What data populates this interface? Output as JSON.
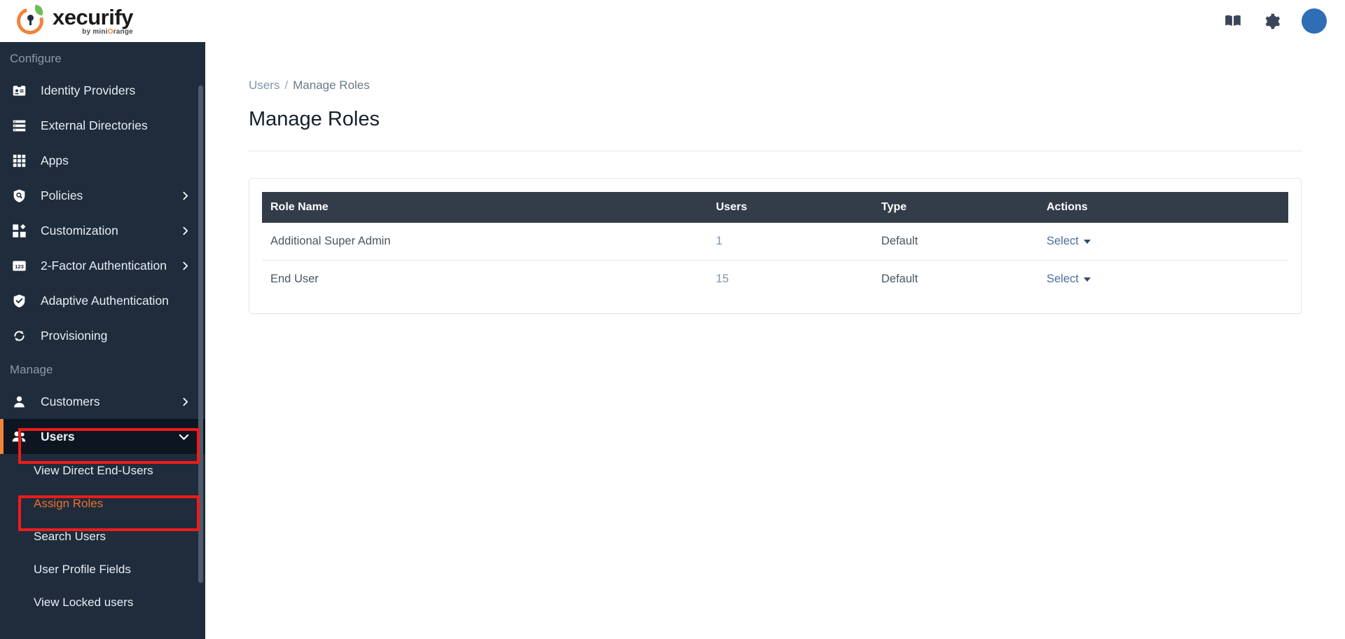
{
  "brand": {
    "name": "xecurify",
    "tagline_prefix": "by mini",
    "tagline_o": "O",
    "tagline_suffix": "range",
    "accent_color": "#f1843c",
    "logo_icon": "xecurify-lock-logo"
  },
  "topbar": {
    "icons": [
      {
        "name": "documentation-book-icon",
        "glyph": "book"
      },
      {
        "name": "settings-gear-icon",
        "glyph": "gear"
      }
    ],
    "avatar": {
      "name": "user-avatar",
      "color": "#2f6db5"
    }
  },
  "sidebar": {
    "sections": [
      {
        "label": "Configure",
        "items": [
          {
            "label": "Identity Providers",
            "icon": "id-badge-icon",
            "chevron": null
          },
          {
            "label": "External Directories",
            "icon": "directory-list-icon",
            "chevron": null
          },
          {
            "label": "Apps",
            "icon": "grid-apps-icon",
            "chevron": null
          },
          {
            "label": "Policies",
            "icon": "shield-search-icon",
            "chevron": "right"
          },
          {
            "label": "Customization",
            "icon": "puzzle-icon",
            "chevron": "right"
          },
          {
            "label": "2-Factor Authentication",
            "icon": "numeric-123-icon",
            "chevron": "right"
          },
          {
            "label": "Adaptive Authentication",
            "icon": "shield-check-icon",
            "chevron": null
          },
          {
            "label": "Provisioning",
            "icon": "sync-arrows-icon",
            "chevron": null
          }
        ]
      },
      {
        "label": "Manage",
        "items": [
          {
            "label": "Customers",
            "icon": "person-icon",
            "chevron": "right"
          },
          {
            "label": "Users",
            "icon": "people-group-icon",
            "chevron": "down",
            "active": true,
            "highlighted": true
          }
        ]
      }
    ],
    "submenu": [
      {
        "label": "View Direct End-Users",
        "selected": false,
        "highlighted": false
      },
      {
        "label": "Assign Roles",
        "selected": true,
        "highlighted": true
      },
      {
        "label": "Search Users",
        "selected": false,
        "highlighted": false
      },
      {
        "label": "User Profile Fields",
        "selected": false,
        "highlighted": false
      },
      {
        "label": "View Locked users",
        "selected": false,
        "highlighted": false
      }
    ],
    "highlight_color": "#ef1b1b",
    "selected_text_color": "#e8702a"
  },
  "breadcrumb": {
    "parent": "Users",
    "separator": "/",
    "current": "Manage Roles"
  },
  "page": {
    "title": "Manage Roles"
  },
  "table": {
    "columns": [
      "Role Name",
      "Users",
      "Type",
      "Actions"
    ],
    "rows": [
      {
        "role_name": "Additional Super Admin",
        "users": "1",
        "type": "Default",
        "action": "Select"
      },
      {
        "role_name": "End User",
        "users": "15",
        "type": "Default",
        "action": "Select"
      }
    ]
  }
}
